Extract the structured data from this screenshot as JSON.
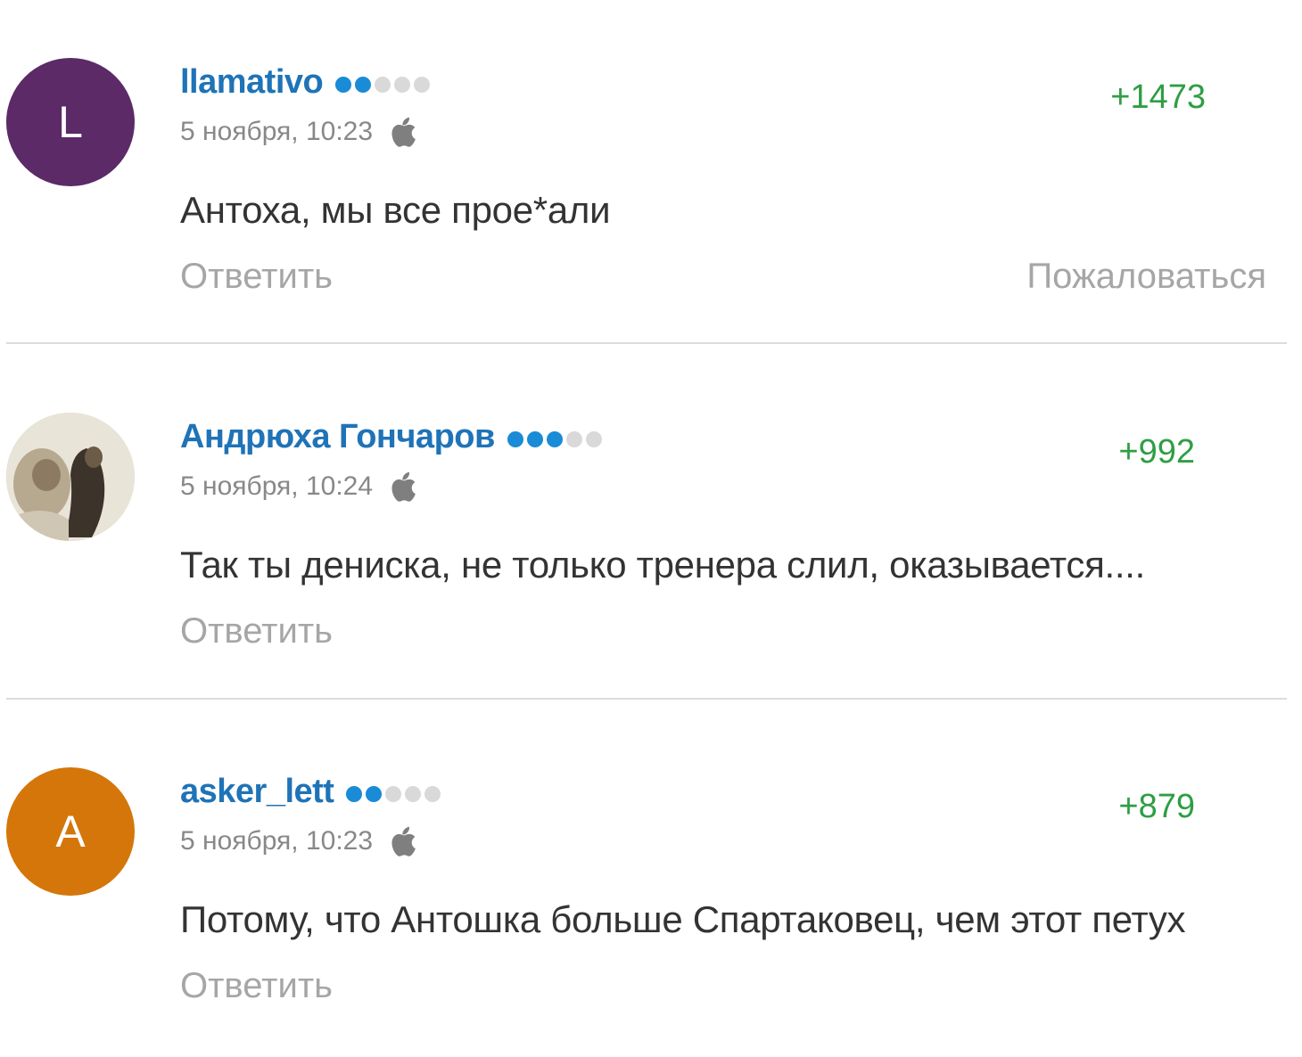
{
  "colors": {
    "author_link": "#1f73b7",
    "score_positive": "#2f9e44",
    "muted_text": "#a6a6a6",
    "rating_filled": "#1a8bd6",
    "rating_empty": "#d9d9d9"
  },
  "comments": [
    {
      "author": "llamativo",
      "avatar_letter": "L",
      "avatar_color": "#5b2a67",
      "rating_filled": 2,
      "rating_total": 5,
      "timestamp": "5 ноября, 10:23",
      "device_icon": "apple-icon",
      "score": "+1473",
      "text": "Антоха, мы все прое*али",
      "reply_label": "Ответить",
      "report_label": "Пожаловаться"
    },
    {
      "author": "Андрюха Гончаров",
      "avatar_letter": "",
      "avatar_color": "",
      "rating_filled": 3,
      "rating_total": 5,
      "timestamp": "5 ноября, 10:24",
      "device_icon": "apple-icon",
      "score": "+992",
      "text": "Так ты дениска, не только тренера слил, оказывается....",
      "reply_label": "Ответить"
    },
    {
      "author": "asker_lett",
      "avatar_letter": "A",
      "avatar_color": "#d4760a",
      "rating_filled": 2,
      "rating_total": 5,
      "timestamp": "5 ноября, 10:23",
      "device_icon": "apple-icon",
      "score": "+879",
      "text": "Потому, что Антошка больше Спартаковец, чем этот петух",
      "reply_label": "Ответить"
    }
  ]
}
